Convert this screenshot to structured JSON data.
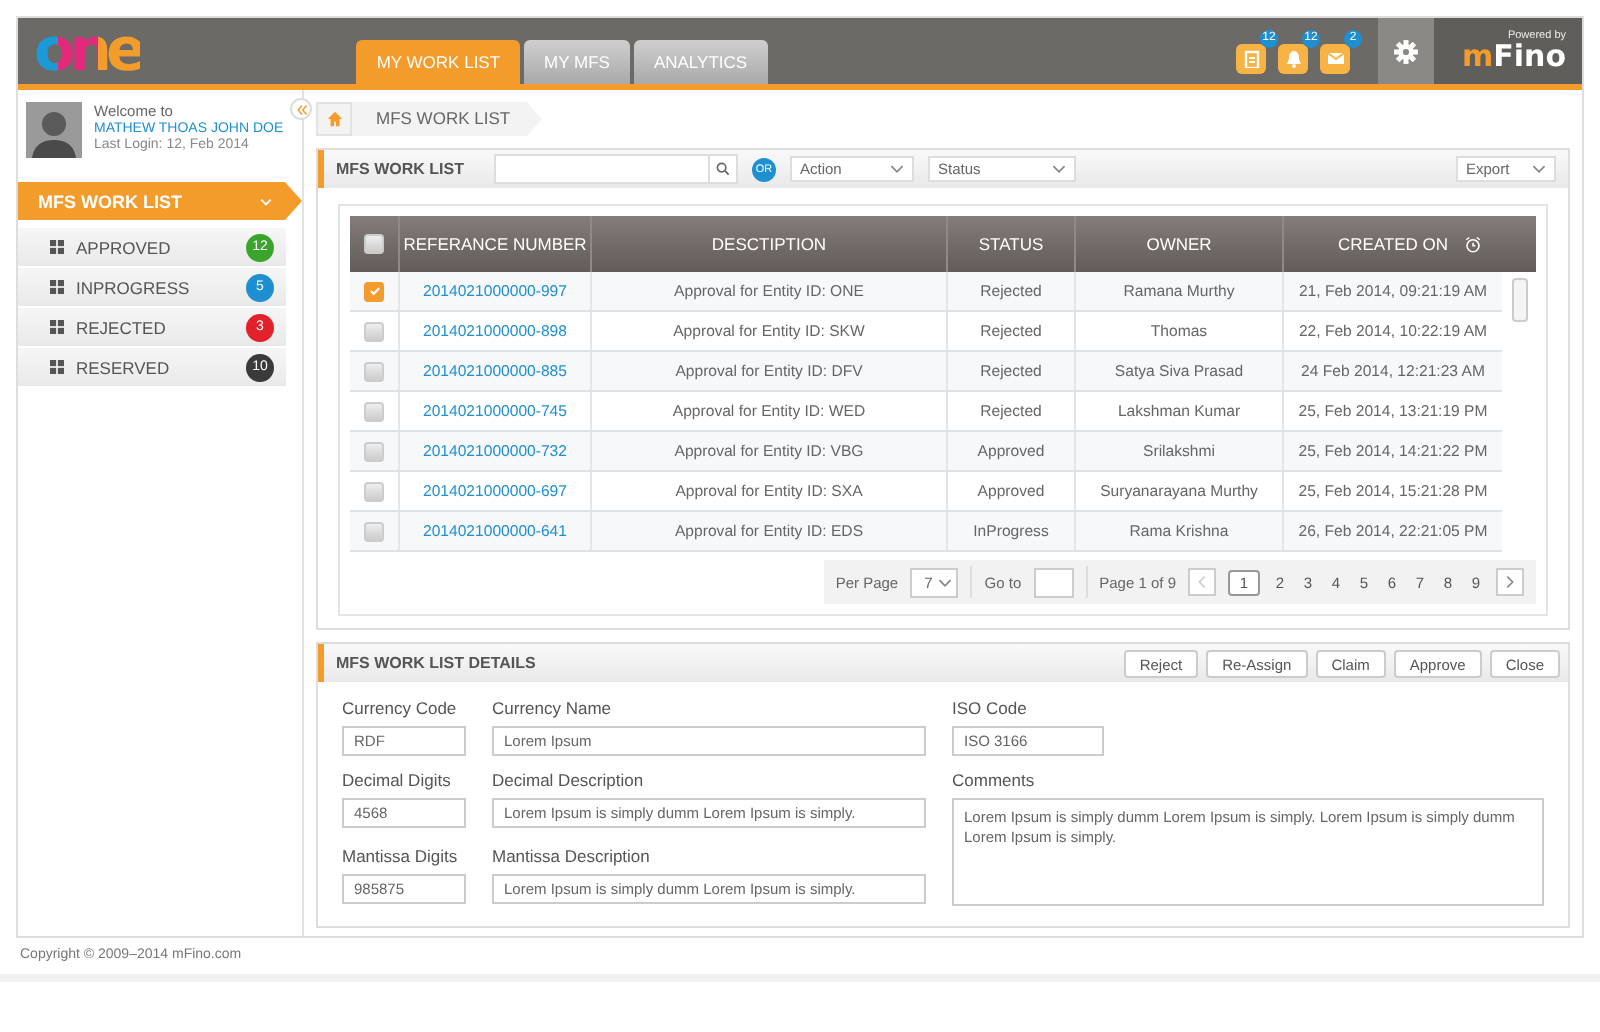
{
  "header": {
    "logo": "one",
    "tabs": [
      {
        "label": "MY WORK LIST",
        "selected": true
      },
      {
        "label": "MY MFS",
        "selected": false
      },
      {
        "label": "ANALYTICS",
        "selected": false
      }
    ],
    "notifications": [
      {
        "kind": "tasks",
        "count": "12"
      },
      {
        "kind": "alerts",
        "count": "12"
      },
      {
        "kind": "mail",
        "count": "2"
      }
    ],
    "powered_by": "Powered by",
    "brand": "mFino"
  },
  "user": {
    "welcome": "Welcome to",
    "name": "MATHEW THOAS JOHN DOE",
    "last_login": "Last Login: 12, Feb 2014"
  },
  "sidebar": {
    "title": "MFS WORK LIST",
    "expanded": true,
    "items": [
      {
        "label": "APPROVED",
        "count": "12",
        "color": "#3aa52c"
      },
      {
        "label": "INPROGRESS",
        "count": "5",
        "color": "#1e8fd0"
      },
      {
        "label": "REJECTED",
        "count": "3",
        "color": "#e3212b"
      },
      {
        "label": "RESERVED",
        "count": "10",
        "color": "#3a3a3a"
      }
    ]
  },
  "breadcrumb": [
    "MFS WORK LIST"
  ],
  "worklist": {
    "title": "MFS WORK LIST",
    "or": "OR",
    "action": "Action",
    "status": "Status",
    "export": "Export",
    "header_checked": false,
    "columns": [
      "REFERANCE NUMBER",
      "DESCTIPTION",
      "STATUS",
      "OWNER",
      "CREATED ON"
    ],
    "rows": [
      {
        "checked": true,
        "ref": "2014021000000-997",
        "description": "Approval for Entity ID: ONE",
        "status": "Rejected",
        "owner": "Ramana Murthy",
        "created": "21, Feb 2014, 09:21:19  AM"
      },
      {
        "checked": false,
        "ref": "2014021000000-898",
        "description": "Approval for Entity ID: SKW",
        "status": "Rejected",
        "owner": "Thomas",
        "created": "22, Feb 2014, 10:22:19  AM"
      },
      {
        "checked": false,
        "ref": "2014021000000-885",
        "description": "Approval for Entity ID: DFV",
        "status": "Rejected",
        "owner": "Satya  Siva Prasad",
        "created": "24 Feb 2014, 12:21:23  AM"
      },
      {
        "checked": false,
        "ref": "2014021000000-745",
        "description": "Approval for Entity ID: WED",
        "status": "Rejected",
        "owner": "Lakshman Kumar",
        "created": "25, Feb 2014, 13:21:19  PM"
      },
      {
        "checked": false,
        "ref": "2014021000000-732",
        "description": "Approval for Entity ID: VBG",
        "status": "Approved",
        "owner": "Srilakshmi",
        "created": "25, Feb 2014, 14:21:22 PM"
      },
      {
        "checked": false,
        "ref": "2014021000000-697",
        "description": "Approval for Entity ID: SXA",
        "status": "Approved",
        "owner": "Suryanarayana Murthy",
        "created": "25, Feb 2014, 15:21:28  PM"
      },
      {
        "checked": false,
        "ref": "2014021000000-641",
        "description": "Approval for Entity ID: EDS",
        "status": "InProgress",
        "owner": "Rama Krishna",
        "created": "26, Feb 2014, 22:21:05  PM"
      }
    ],
    "pagination": {
      "per_page_label": "Per Page",
      "per_page": "7",
      "goto_label": "Go to",
      "page_info": "Page 1 of 9",
      "pages": [
        {
          "label": "1",
          "selected": true
        },
        {
          "label": "2",
          "selected": false
        },
        {
          "label": "3",
          "selected": false
        },
        {
          "label": "4",
          "selected": false
        },
        {
          "label": "5",
          "selected": false
        },
        {
          "label": "6",
          "selected": false
        },
        {
          "label": "7",
          "selected": false
        },
        {
          "label": "8",
          "selected": false
        },
        {
          "label": "9",
          "selected": false
        }
      ]
    }
  },
  "details": {
    "title": "MFS WORK LIST DETAILS",
    "buttons": [
      "Reject",
      "Re-Assign",
      "Claim",
      "Approve",
      "Close"
    ],
    "fields": [
      {
        "kind": "short",
        "label": "Currency Code",
        "value": "RDF"
      },
      {
        "kind": "wide",
        "label": "Currency Name",
        "value": "Lorem Ipsum"
      },
      {
        "kind": "iso",
        "label": "ISO Code",
        "value": "ISO 3166"
      },
      {
        "kind": "short",
        "label": "Decimal Digits",
        "value": "4568"
      },
      {
        "kind": "wide",
        "label": "Decimal Description",
        "value": "Lorem Ipsum is simply dumm Lorem Ipsum is simply."
      },
      {
        "kind": "area",
        "label": "Comments",
        "value": "Lorem Ipsum is simply dumm Lorem Ipsum is simply. Lorem Ipsum is simply dumm Lorem Ipsum is simply."
      },
      {
        "kind": "short",
        "label": "Mantissa Digits",
        "value": "985875"
      },
      {
        "kind": "wide",
        "label": "Mantissa Description",
        "value": "Lorem Ipsum is simply dumm Lorem Ipsum is simply."
      }
    ]
  },
  "footer": "Copyright © 2009–2014 mFino.com"
}
